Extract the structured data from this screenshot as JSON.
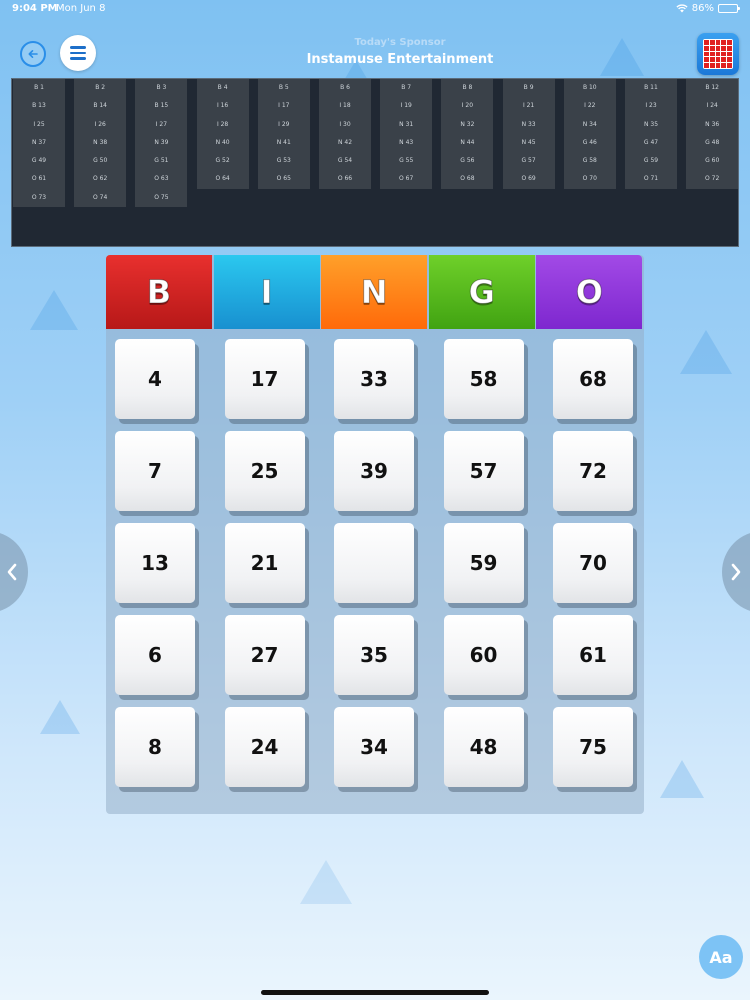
{
  "status_bar": {
    "time": "9:04 PM",
    "date": "Mon Jun 8",
    "battery_text": "86%",
    "battery_level": 0.86
  },
  "header": {
    "sponsor_label": "Today's Sponsor",
    "sponsor_name": "Instamuse Entertainment"
  },
  "called_board": [
    [
      "B 1",
      "B 13",
      "I 25",
      "N 37",
      "G 49",
      "O 61",
      "O 73"
    ],
    [
      "B 2",
      "B 14",
      "I 26",
      "N 38",
      "G 50",
      "O 62",
      "O 74"
    ],
    [
      "B 3",
      "B 15",
      "I 27",
      "N 39",
      "G 51",
      "O 63",
      "O 75"
    ],
    [
      "B 4",
      "I 16",
      "I 28",
      "N 40",
      "G 52",
      "O 64"
    ],
    [
      "B 5",
      "I 17",
      "I 29",
      "N 41",
      "G 53",
      "O 65"
    ],
    [
      "B 6",
      "I 18",
      "I 30",
      "N 42",
      "G 54",
      "O 66"
    ],
    [
      "B 7",
      "I 19",
      "N 31",
      "N 43",
      "G 55",
      "O 67"
    ],
    [
      "B 8",
      "I 20",
      "N 32",
      "N 44",
      "G 56",
      "O 68"
    ],
    [
      "B 9",
      "I 21",
      "N 33",
      "N 45",
      "G 57",
      "O 69"
    ],
    [
      "B 10",
      "I 22",
      "N 34",
      "G 46",
      "G 58",
      "O 70"
    ],
    [
      "B 11",
      "I 23",
      "N 35",
      "G 47",
      "G 59",
      "O 71"
    ],
    [
      "B 12",
      "I 24",
      "N 36",
      "G 48",
      "G 60",
      "O 72"
    ]
  ],
  "card": {
    "letters": [
      "B",
      "I",
      "N",
      "G",
      "O"
    ],
    "colors": [
      "#d42424",
      "#22acdf",
      "#ff8419",
      "#55b91d",
      "#9238db"
    ],
    "rows": [
      [
        "4",
        "17",
        "33",
        "58",
        "68"
      ],
      [
        "7",
        "25",
        "39",
        "57",
        "72"
      ],
      [
        "13",
        "21",
        "",
        "59",
        "70"
      ],
      [
        "6",
        "27",
        "35",
        "60",
        "61"
      ],
      [
        "8",
        "24",
        "34",
        "48",
        "75"
      ]
    ]
  },
  "footer": {
    "font_button_label": "Aa"
  }
}
